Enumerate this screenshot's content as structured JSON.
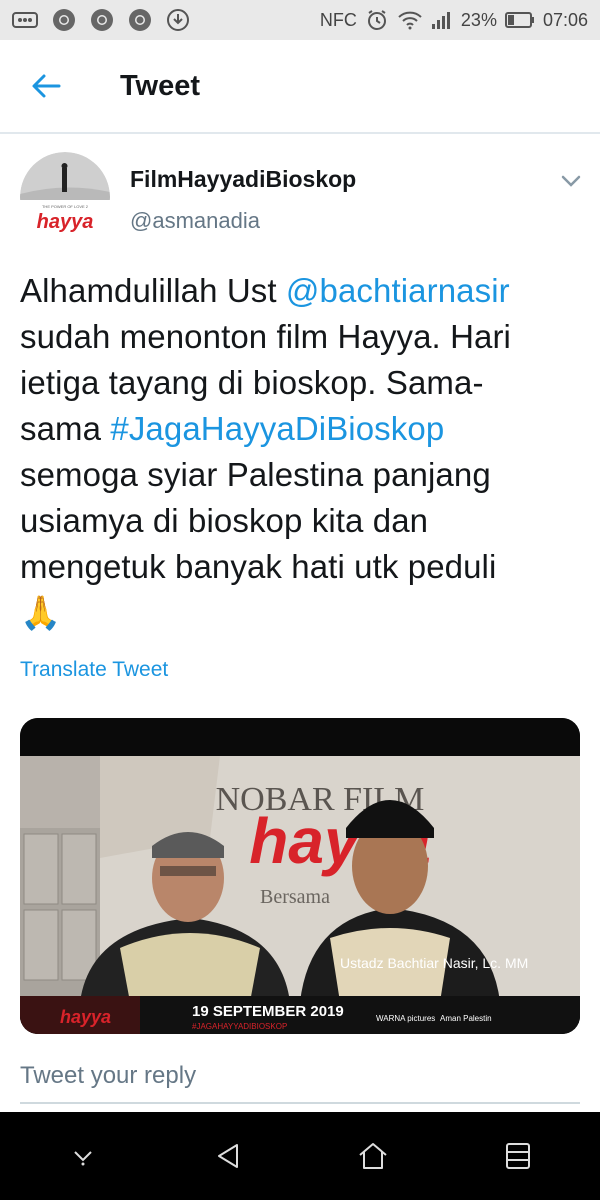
{
  "status_bar": {
    "nfc": "NFC",
    "battery": "23%",
    "time": "07:06",
    "icons": [
      "voicemail-icon",
      "chrome-icon",
      "chrome-icon",
      "chrome-icon",
      "download-icon",
      "nfc-icon",
      "alarm-icon",
      "wifi-icon",
      "signal-icon",
      "battery-icon"
    ]
  },
  "header": {
    "title": "Tweet",
    "back_icon": "back-arrow-icon"
  },
  "tweet": {
    "author_name": "FilmHayyadiBioskop",
    "author_handle": "@asmanadia",
    "avatar_text": "hayya",
    "avatar_tagline": "THE POWER OF LOVE 2",
    "lines": [
      {
        "pre": "Alhamdulillah Ust ",
        "link": "@bachtiarnasir",
        "post": ""
      },
      {
        "pre": "sudah menonton film Hayya. Hari",
        "link": "",
        "post": ""
      },
      {
        "pre": "ietiga tayang di bioskop. Sama-",
        "link": "",
        "post": ""
      },
      {
        "pre": "sama  ",
        "link": "#JagaHayyaDiBioskop",
        "post": ""
      },
      {
        "pre": "semoga syiar Palestina panjang",
        "link": "",
        "post": ""
      },
      {
        "pre": "usiamya di bioskop kita dan",
        "link": "",
        "post": ""
      },
      {
        "pre": "mengetuk banyak hati utk peduli",
        "link": "",
        "post": ""
      }
    ],
    "emoji": "🙏",
    "translate_label": "Translate Tweet"
  },
  "media": {
    "banner_title": "NOBAR FILM",
    "banner_brand": "hayya",
    "banner_with": "Bersama",
    "caption": "Ustadz Bachtiar Nasir, Lc. MM",
    "date": "19 SEPTEMBER 2019",
    "hashtag": "#JAGAHAYYADIBIOSKOP",
    "logo_small": "hayya",
    "sponsor_1": "WARNA pictures",
    "sponsor_2": "Aman Palestin"
  },
  "reply": {
    "placeholder": "Tweet your reply"
  },
  "nav": {
    "icons": [
      "chevron-down-icon",
      "back-triangle-icon",
      "home-icon",
      "recents-icon"
    ]
  },
  "colors": {
    "link": "#1b95e0",
    "secondary_text": "#657786",
    "status_bar_bg": "#e9e9e9",
    "nav_bg": "#000000"
  }
}
